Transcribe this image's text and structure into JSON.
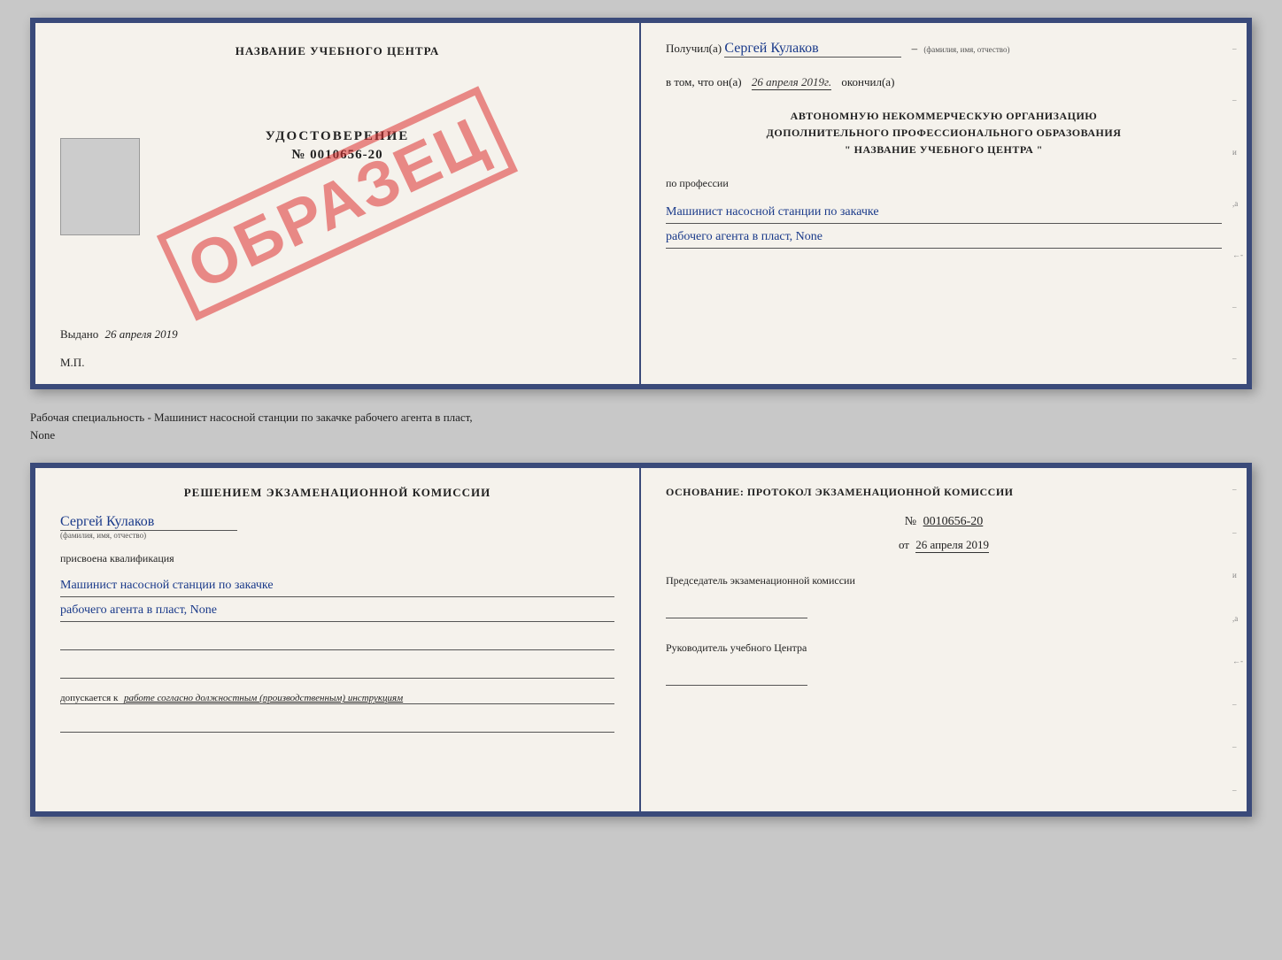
{
  "top_document": {
    "left": {
      "org_title": "НАЗВАНИЕ УЧЕБНОГО ЦЕНТРА",
      "sample_stamp": "ОБРАЗЕЦ",
      "certificate_label": "УДОСТОВЕРЕНИЕ",
      "certificate_number": "№ 0010656-20",
      "issued_label": "Выдано",
      "issued_date": "26 апреля 2019",
      "mp_label": "М.П."
    },
    "right": {
      "received_prefix": "Получил(а)",
      "received_name": "Сергей Кулаков",
      "fio_hint": "(фамилия, имя, отчество)",
      "date_prefix": "в том, что он(а)",
      "date_value": "26 апреля 2019г.",
      "date_suffix": "окончил(а)",
      "org_line1": "АВТОНОМНУЮ НЕКОММЕРЧЕСКУЮ ОРГАНИЗАЦИЮ",
      "org_line2": "ДОПОЛНИТЕЛЬНОГО ПРОФЕССИОНАЛЬНОГО ОБРАЗОВАНИЯ",
      "org_line3": "\" НАЗВАНИЕ УЧЕБНОГО ЦЕНТРА \"",
      "profession_label": "по профессии",
      "profession_line1": "Машинист насосной станции по закачке",
      "profession_line2": "рабочего агента в пласт, None"
    }
  },
  "separator": {
    "text": "Рабочая специальность - Машинист насосной станции по закачке рабочего агента в пласт,",
    "text2": "None"
  },
  "bottom_document": {
    "left": {
      "commission_title": "Решением экзаменационной комиссии",
      "signer_name": "Сергей Кулаков",
      "fio_hint": "(фамилия, имя, отчество)",
      "qualification_label": "присвоена квалификация",
      "qualification_line1": "Машинист насосной станции по закачке",
      "qualification_line2": "рабочего агента в пласт, None",
      "work_prefix": "допускается к",
      "work_value": "работе согласно должностным (производственным) инструкциям"
    },
    "right": {
      "basis_title": "Основание: протокол экзаменационной комиссии",
      "protocol_label": "№",
      "protocol_number": "0010656-20",
      "date_prefix": "от",
      "date_value": "26 апреля 2019",
      "chairman_label": "Председатель экзаменационной комиссии",
      "head_label": "Руководитель учебного Центра"
    }
  }
}
